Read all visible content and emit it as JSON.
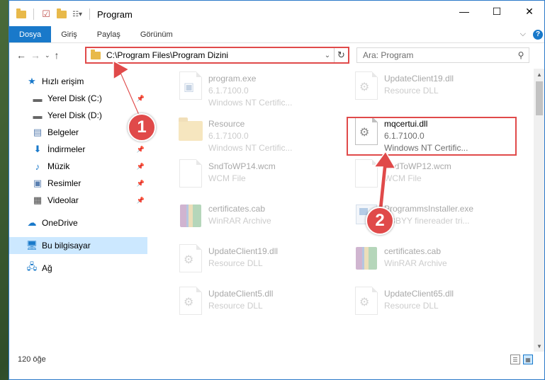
{
  "window": {
    "title": "Program",
    "controls": {
      "minimize": "—",
      "maximize": "☐",
      "close": "✕"
    }
  },
  "ribbon": {
    "tabs": [
      "Dosya",
      "Giriş",
      "Paylaş",
      "Görünüm"
    ],
    "expand": "⌵",
    "help": "?"
  },
  "address": {
    "path": "C:\\Program Files\\Program Dizini",
    "search_placeholder": "Ara: Program"
  },
  "sidebar": {
    "quick_access": "Hızlı erişim",
    "items": [
      {
        "label": "Yerel Disk (C:)",
        "icon": "drive-icon",
        "pinned": true
      },
      {
        "label": "Yerel Disk (D:)",
        "icon": "drive-icon",
        "pinned": false
      },
      {
        "label": "Belgeler",
        "icon": "documents-icon",
        "pinned": true
      },
      {
        "label": "İndirmeler",
        "icon": "download-icon",
        "pinned": true
      },
      {
        "label": "Müzik",
        "icon": "music-icon",
        "pinned": true
      },
      {
        "label": "Resimler",
        "icon": "pictures-icon",
        "pinned": true
      },
      {
        "label": "Videolar",
        "icon": "videos-icon",
        "pinned": true
      }
    ],
    "onedrive": "OneDrive",
    "this_pc": "Bu bilgisayar",
    "network": "Ağ"
  },
  "files": [
    {
      "name": "program.exe",
      "line1": "6.1.7100.0",
      "line2": "Windows NT Certific...",
      "icon": "exe"
    },
    {
      "name": "UpdateClient19.dll",
      "line1": "Resource DLL",
      "line2": "",
      "icon": "dll"
    },
    {
      "name": "Resource",
      "line1": "6.1.7100.0",
      "line2": "Windows NT Certific...",
      "icon": "folder"
    },
    {
      "name": "mqcertui.dll",
      "line1": "6.1.7100.0",
      "line2": "Windows NT Certific...",
      "icon": "dll"
    },
    {
      "name": "SndToWP14.wcm",
      "line1": "WCM File",
      "line2": "",
      "icon": "blank"
    },
    {
      "name": "SndToWP12.wcm",
      "line1": "WCM File",
      "line2": "",
      "icon": "blank"
    },
    {
      "name": "certificates.cab",
      "line1": "WinRAR Archive",
      "line2": "",
      "icon": "rar"
    },
    {
      "name": "ProgrammsInstaller.exe",
      "line1": "ABBYY finereader tri...",
      "line2": "",
      "icon": "exe2"
    },
    {
      "name": "UpdateClient19.dll",
      "line1": "Resource DLL",
      "line2": "",
      "icon": "dll"
    },
    {
      "name": "certificates.cab",
      "line1": "WinRAR Archive",
      "line2": "",
      "icon": "rar"
    },
    {
      "name": "UpdateClient5.dll",
      "line1": "Resource DLL",
      "line2": "",
      "icon": "dll"
    },
    {
      "name": "UpdateClient65.dll",
      "line1": "Resource DLL",
      "line2": "",
      "icon": "dll"
    }
  ],
  "status": {
    "count": "120 öğe"
  },
  "annotations": {
    "step1": "1",
    "step2": "2"
  },
  "colors": {
    "accent": "#1979ca",
    "highlight": "#e04a4a",
    "selected": "#cce8ff"
  }
}
